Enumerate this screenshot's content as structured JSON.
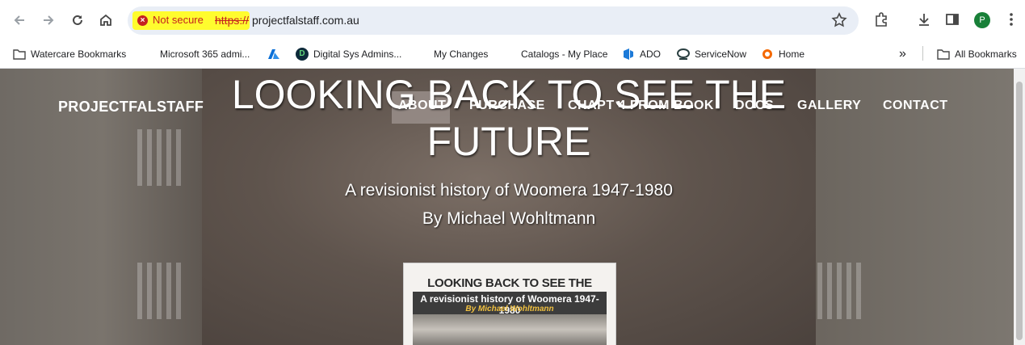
{
  "browser": {
    "security_label": "Not secure",
    "url_scheme": "https://",
    "url_host": "projectfalstaff.com.au",
    "profile_initial": "P",
    "bookmarks": [
      {
        "label": "Watercare Bookmarks",
        "icon": "folder-icon"
      },
      {
        "label": "Microsoft 365 admi...",
        "icon": "microsoft-icon"
      },
      {
        "label": "",
        "icon": "azure-icon"
      },
      {
        "label": "Digital Sys Admins...",
        "icon": "circle-d-icon"
      },
      {
        "label": "My Changes",
        "icon": "microsoft-icon"
      },
      {
        "label": "Catalogs - My Place",
        "icon": "microsoft-icon"
      },
      {
        "label": "ADO",
        "icon": "azure-devops-icon"
      },
      {
        "label": "ServiceNow",
        "icon": "servicenow-icon"
      },
      {
        "label": "Home",
        "icon": "grafana-icon"
      }
    ],
    "more_bookmarks": "»",
    "all_bookmarks": "All Bookmarks"
  },
  "site": {
    "brand": "PROJECTFALSTAFF",
    "nav": [
      "ABOUT",
      "PURCHASE",
      "CHAPT 4 FROM BOOK",
      "DOCS",
      "GALLERY",
      "CONTACT"
    ],
    "hero_title_line1": "LOOKING BACK TO SEE THE",
    "hero_title_line2": "FUTURE",
    "hero_subtitle": "A revisionist history of Woomera 1947-1980",
    "hero_author": "By Michael Wohltmann",
    "book_cover": {
      "title": "LOOKING BACK TO SEE THE FUTURE",
      "subtitle": "A revisionist history of Woomera 1947-1980",
      "author": "By Michael Wohltmann"
    }
  },
  "colors": {
    "security_highlight": "#fffc2e",
    "insecure_red": "#c5221f",
    "profile_green": "#188038"
  }
}
